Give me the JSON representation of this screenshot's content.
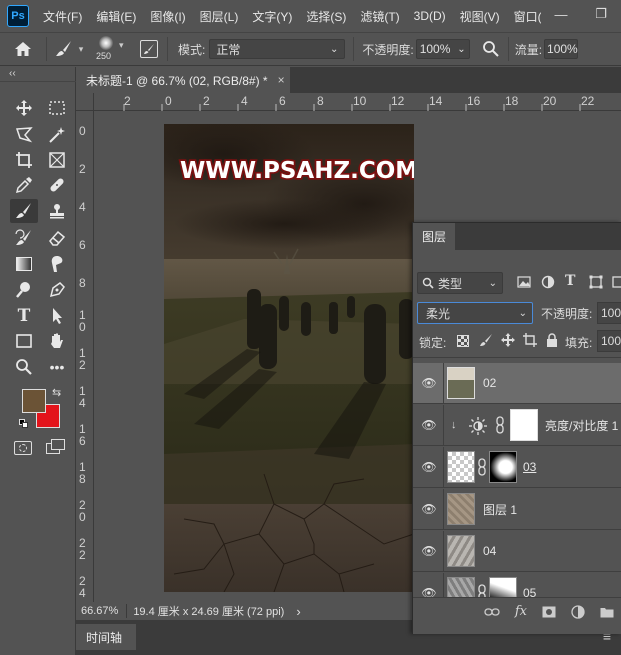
{
  "app": {
    "logo": "Ps"
  },
  "menu": [
    "文件(F)",
    "编辑(E)",
    "图像(I)",
    "图层(L)",
    "文字(Y)",
    "选择(S)",
    "滤镜(T)",
    "3D(D)",
    "视图(V)",
    "窗口("
  ],
  "window_controls": {
    "minimize": "—",
    "restore": "❐"
  },
  "options": {
    "brush_size": "250",
    "mode_label": "模式:",
    "mode_value": "正常",
    "opacity_label": "不透明度:",
    "opacity_value": "100%",
    "flow_label": "流量:",
    "flow_value": "100%"
  },
  "toolbar": {
    "collapse": "‹‹",
    "foreground_color": "#6b5336",
    "background_color": "#e3141b"
  },
  "document": {
    "tab_title": "未标题-1 @ 66.7% (02, RGB/8#) *",
    "close": "×",
    "ruler_top": [
      "2",
      "0",
      "2",
      "4",
      "6",
      "8",
      "10",
      "12",
      "14",
      "16",
      "18",
      "20",
      "22"
    ],
    "ruler_left": [
      "0",
      "2",
      "4",
      "6",
      "8",
      "1 0",
      "1 2",
      "1 4",
      "1 6",
      "1 8",
      "2 0",
      "2 2",
      "2 4"
    ],
    "watermark": "WWW.PSAHZ.COM"
  },
  "status": {
    "zoom": "66.67%",
    "size_info": "19.4 厘米 x 24.69 厘米 (72 ppi)",
    "arrow": "›"
  },
  "timeline": {
    "tab": "时间轴",
    "menu_icon": "≡"
  },
  "layers": {
    "tab": "图层",
    "filter_label": "类型",
    "blend_mode": "柔光",
    "opacity_label": "不透明度:",
    "opacity_value": "100",
    "lock_label": "锁定:",
    "fill_label": "填充:",
    "fill_value": "100",
    "items": [
      {
        "name": "02"
      },
      {
        "name": "亮度/对比度 1"
      },
      {
        "name": "03"
      },
      {
        "name": "图层 1"
      },
      {
        "name": "04"
      },
      {
        "name": "05"
      }
    ],
    "footer_fx": "fx"
  }
}
